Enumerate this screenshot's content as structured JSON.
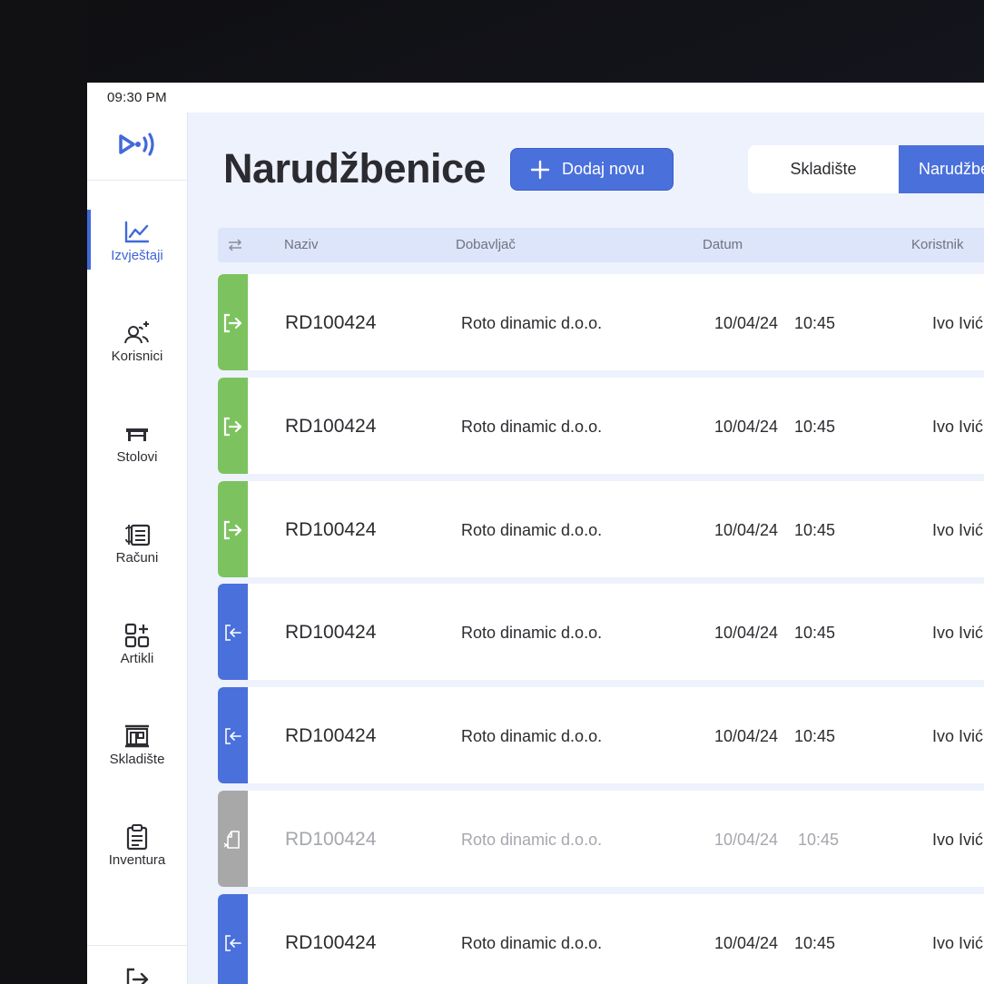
{
  "status": {
    "time": "09:30 PM"
  },
  "sidebar": {
    "items": [
      {
        "label": "Izvještaji",
        "icon": "chart-line-icon",
        "active": true
      },
      {
        "label": "Korisnici",
        "icon": "users-add-icon"
      },
      {
        "label": "Stolovi",
        "icon": "table-icon"
      },
      {
        "label": "Računi",
        "icon": "receipt-icon"
      },
      {
        "label": "Artikli",
        "icon": "grid-add-icon"
      },
      {
        "label": "Skladište",
        "icon": "warehouse-icon"
      },
      {
        "label": "Inventura",
        "icon": "clipboard-icon"
      }
    ],
    "bottom_icon": "logout-icon"
  },
  "header": {
    "title": "Narudžbenice",
    "add_label": "Dodaj novu",
    "segments": [
      "Skladište",
      "Narudžbenice"
    ],
    "active_segment": "Narudžbenice"
  },
  "table": {
    "columns": [
      "Naziv",
      "Dobavljač",
      "Datum",
      "Koristnik"
    ],
    "rows": [
      {
        "code": "RD100424",
        "supplier": "Roto dinamic d.o.o.",
        "date": "10/04/24",
        "time": "10:45",
        "user": "Ivo Ivić",
        "status": "outgoing",
        "color": "#7cc35f"
      },
      {
        "code": "RD100424",
        "supplier": "Roto dinamic d.o.o.",
        "date": "10/04/24",
        "time": "10:45",
        "user": "Ivo Ivić",
        "status": "outgoing",
        "color": "#7cc35f"
      },
      {
        "code": "RD100424",
        "supplier": "Roto dinamic d.o.o.",
        "date": "10/04/24",
        "time": "10:45",
        "user": "Ivo Ivić",
        "status": "outgoing",
        "color": "#7cc35f"
      },
      {
        "code": "RD100424",
        "supplier": "Roto dinamic d.o.o.",
        "date": "10/04/24",
        "time": "10:45",
        "user": "Ivo Ivić",
        "status": "incoming",
        "color": "#4a70dc"
      },
      {
        "code": "RD100424",
        "supplier": "Roto dinamic d.o.o.",
        "date": "10/04/24",
        "time": "10:45",
        "user": "Ivo Ivić",
        "status": "incoming",
        "color": "#4a70dc"
      },
      {
        "code": "RD100424",
        "supplier": "Roto dinamic d.o.o.",
        "date": "10/04/24",
        "time": "10:45",
        "user": "Ivo Ivić",
        "status": "cancelled",
        "color": "#a8a8a8"
      },
      {
        "code": "RD100424",
        "supplier": "Roto dinamic d.o.o.",
        "date": "10/04/24",
        "time": "10:45",
        "user": "Ivo Ivić",
        "status": "incoming",
        "color": "#4a70dc"
      }
    ]
  },
  "colors": {
    "accent": "#4a70dc",
    "background": "#eef2fd",
    "success": "#7cc35f",
    "muted": "#a8a8a8"
  }
}
